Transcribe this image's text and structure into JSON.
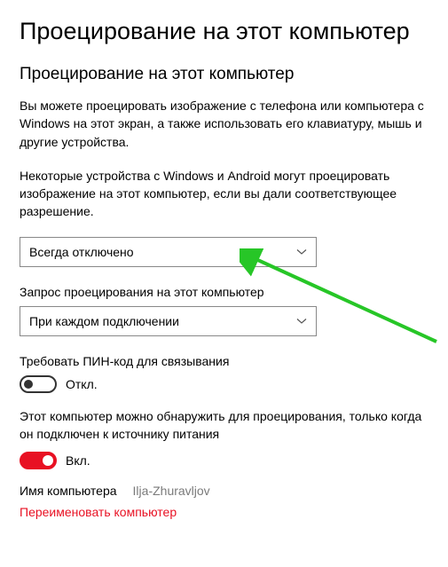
{
  "page": {
    "title": "Проецирование на этот компьютер",
    "section_title": "Проецирование на этот компьютер",
    "intro": "Вы можете проецировать изображение с телефона или компьютера с Windows на этот экран, а также использовать его клавиатуру, мышь и другие устройства."
  },
  "permission": {
    "label": "Некоторые устройства с Windows и Android могут проецировать изображение на этот компьютер, если вы дали соответствующее разрешение.",
    "value": "Всегда отключено"
  },
  "request": {
    "label": "Запрос проецирования на этот компьютер",
    "value": "При каждом подключении"
  },
  "pin": {
    "label": "Требовать ПИН-код для связывания",
    "state": "Откл."
  },
  "discover": {
    "label": "Этот компьютер можно обнаружить для проецирования, только когда он подключен к источнику питания",
    "state": "Вкл."
  },
  "computer": {
    "label": "Имя компьютера",
    "value": "Ilja-Zhuravljov"
  },
  "rename_link": "Переименовать компьютер"
}
